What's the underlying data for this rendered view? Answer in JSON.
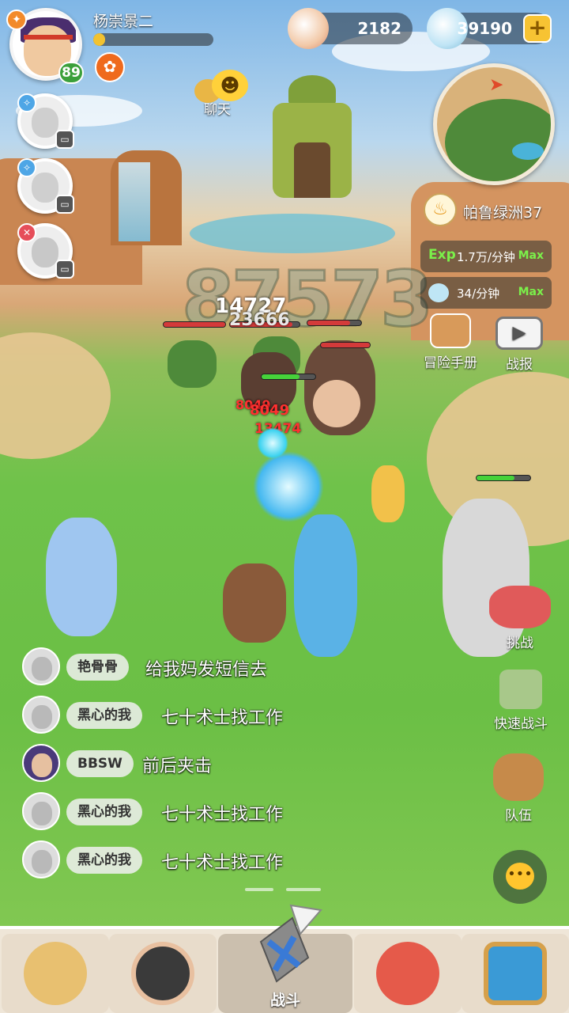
{
  "player": {
    "name": "杨崇景二",
    "level": "89",
    "xp_fraction": 0.1
  },
  "chat_top_label": "聊天",
  "resources": {
    "pearls": "2182",
    "shells": "39190",
    "plus": "+"
  },
  "location": {
    "name": "帕鲁绿洲37"
  },
  "rates": [
    {
      "key": "Exp",
      "value": "1.7万/分钟",
      "max": "Max"
    },
    {
      "value": "34/分钟",
      "max": "Max"
    }
  ],
  "side_buttons": {
    "handbook": "冒险手册",
    "report": "战报",
    "challenge": "挑战",
    "quick": "快速战斗",
    "team": "队伍"
  },
  "battle": {
    "big_number": "87573",
    "dmg1": "14727",
    "dmg2": "23666",
    "dmg3": "8049",
    "dmg4": "8049",
    "dmg5": "13474"
  },
  "chat_feed": [
    {
      "name": "艳骨骨",
      "text": "给我妈发短信去"
    },
    {
      "name": "黑心的我",
      "text": "七十术士找工作"
    },
    {
      "name": "BBSW",
      "text": "前后夹击"
    },
    {
      "name": "黑心的我",
      "text": "七十术士找工作"
    },
    {
      "name": "黑心的我",
      "text": "七十术士找工作"
    }
  ],
  "nav": {
    "battle_label": "战斗"
  },
  "icons": {
    "chat": "chat-bubble-icon",
    "map_arrow": "map-arrow-icon",
    "lamp": "lamp-icon"
  },
  "colors": {
    "accent_green": "#7bf04a",
    "hp_red": "#d43a3a",
    "hp_green": "#46d23a",
    "gold": "#f7c333"
  }
}
